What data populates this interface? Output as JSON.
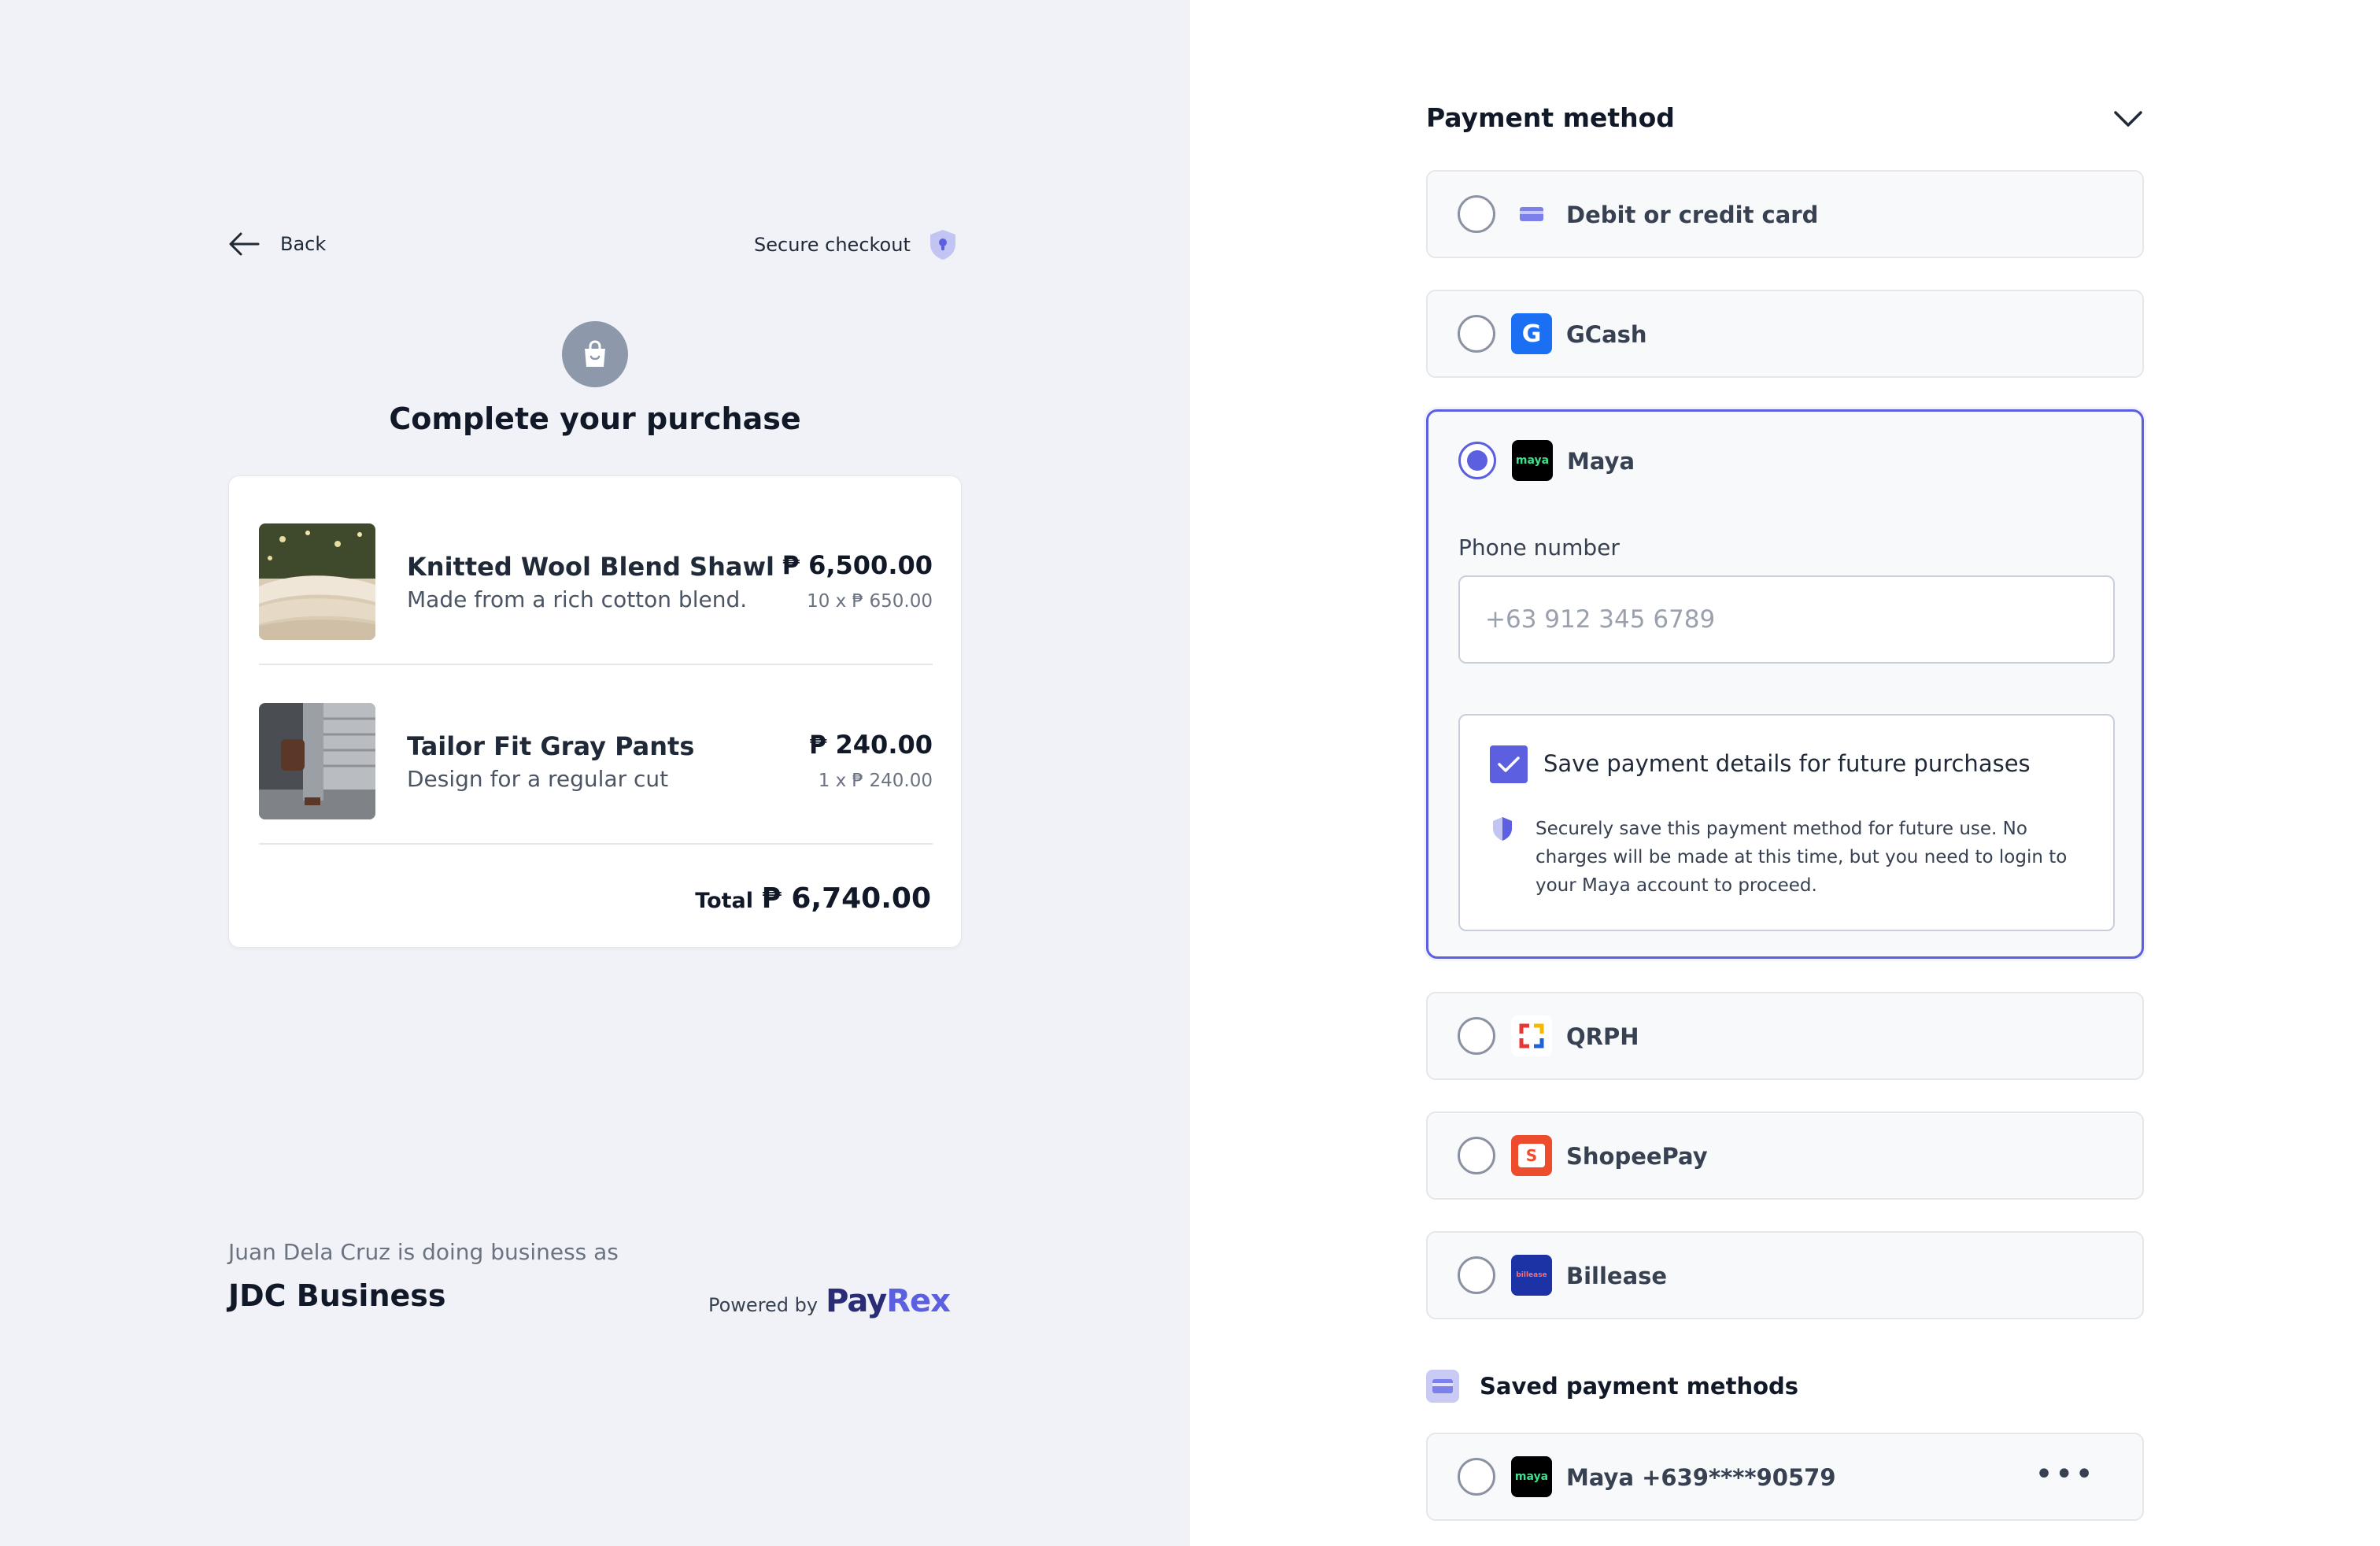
{
  "left": {
    "back_label": "Back",
    "secure_label": "Secure checkout",
    "title": "Complete your purchase",
    "items": [
      {
        "name": "Knitted Wool Blend Shawl",
        "desc": "Made from a rich cotton blend.",
        "price": "₱ 6,500.00",
        "qty": "10 x ₱ 650.00"
      },
      {
        "name": "Tailor Fit Gray Pants",
        "desc": "Design for a regular cut",
        "price": "₱ 240.00",
        "qty": "1 x ₱ 240.00"
      }
    ],
    "total_label": "Total",
    "total_value": "₱ 6,740.00",
    "business_line": "Juan Dela Cruz is doing business as",
    "business_name": "JDC Business",
    "powered_by": "Powered by",
    "logo_pay": "Pay",
    "logo_rex": "Rex"
  },
  "right": {
    "title": "Payment method",
    "options": [
      {
        "label": "Debit or credit card",
        "selected": false
      },
      {
        "label": "GCash",
        "selected": false
      },
      {
        "label": "Maya",
        "selected": true
      },
      {
        "label": "QRPH",
        "selected": false
      },
      {
        "label": "ShopeePay",
        "selected": false
      },
      {
        "label": "Billease",
        "selected": false
      }
    ],
    "maya": {
      "phone_label": "Phone number",
      "phone_placeholder": "+63 912 345 6789",
      "save_label": "Save payment details for future purchases",
      "save_checked": true,
      "note": "Securely save this payment method for future use. No charges will be made at this time, but you need to login to your Maya account to proceed."
    },
    "saved_title": "Saved payment methods",
    "saved": [
      {
        "label": "Maya +639****90579"
      }
    ],
    "icon_text": {
      "gcash": "G",
      "maya": "maya",
      "shopee": "S",
      "billease": "billease"
    }
  },
  "colors": {
    "accent": "#5b5fe0",
    "left_bg": "#f0f2f7",
    "gcash": "#1b6ff2",
    "maya": "#000000",
    "maya_text": "#3de08c",
    "shopee": "#ee4d2d",
    "billease": "#1c33a6"
  }
}
